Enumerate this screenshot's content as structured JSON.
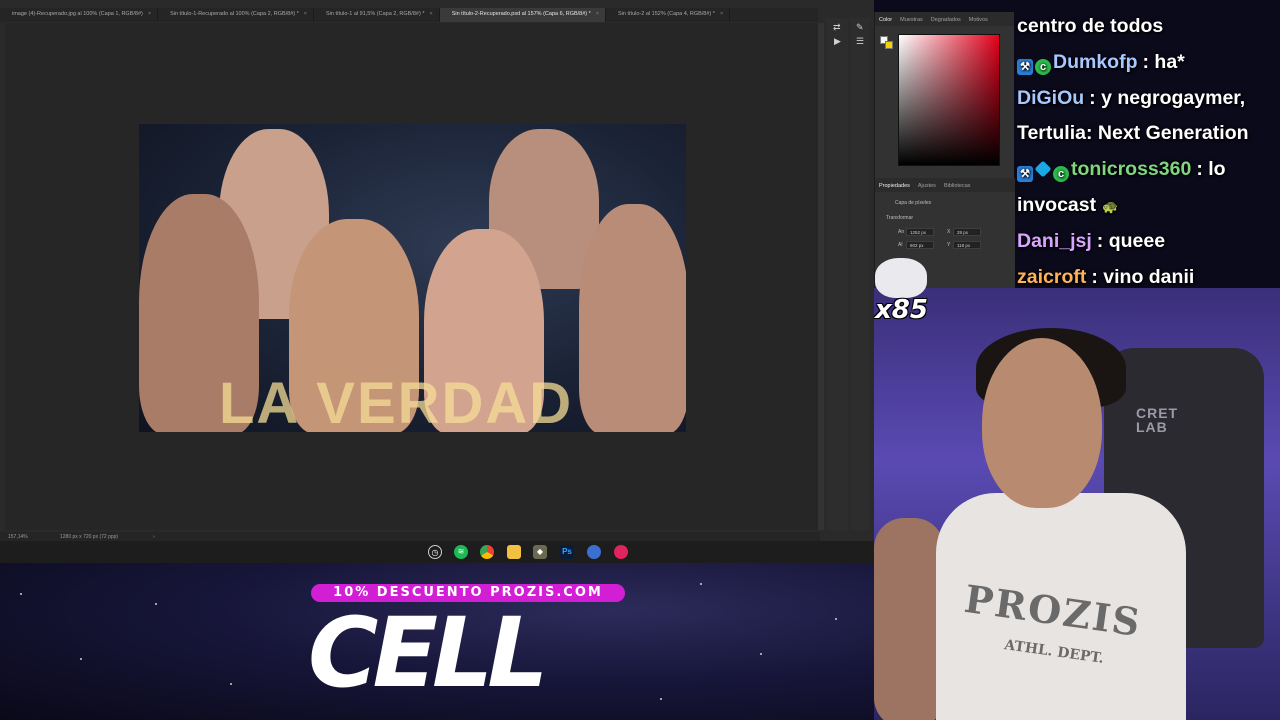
{
  "photoshop": {
    "tabs": [
      {
        "label": "image (4)-Recuperado.jpg al 100% (Capa 1, RGB/8#)",
        "close": "×",
        "active": false
      },
      {
        "label": "Sin título-1-Recuperado al 100% (Capa 2, RGB/8#) *",
        "close": "×",
        "active": false
      },
      {
        "label": "Sin título-1 al 91,5% (Capa 2, RGB/8#) *",
        "close": "×",
        "active": false
      },
      {
        "label": "Sin título-2-Recuperado.psd al 157% (Capa 6, RGB/8#) *",
        "close": "×",
        "active": true
      },
      {
        "label": "Sin título-2 al 152% (Capa 4, RGB/8#) *",
        "close": "×",
        "active": false
      }
    ],
    "canvas_title": "LA VERDAD",
    "status": {
      "zoom": "157,14%",
      "doc_size": "1280 px x 720 px (72 ppp)",
      "arrow": "›"
    }
  },
  "panels": {
    "top_tabs": [
      "Color",
      "Muestras",
      "Degradados",
      "Motivos"
    ],
    "bottom_tabs": [
      "Propiedades",
      "Ajustes",
      "Bibliotecas"
    ],
    "layer_type": "Capa de píxeles",
    "section": "Transformar",
    "fields": {
      "w_label": "An",
      "w": "1252 px",
      "x_label": "X",
      "x": "28 px",
      "h_label": "Al",
      "h": "602 px",
      "y_label": "Y",
      "y": "118 px"
    },
    "colors": {
      "foreground": "#f7f7f7",
      "background": "#f3d200"
    }
  },
  "chat": {
    "lines": [
      {
        "user": "",
        "text": "centro de todos",
        "color": "#ffffff"
      },
      {
        "user": "Dumkofp",
        "text": ": ha*",
        "color": "#a6c8ff",
        "badges": [
          "blue",
          "green"
        ]
      },
      {
        "user": "DiGiOu",
        "text": ": y negrogaymer,",
        "color": "#a6c8ff",
        "badges": []
      },
      {
        "user": "",
        "text": "Tertulia: Next Generation",
        "color": "#ffffff"
      },
      {
        "user": "tonicross360",
        "text": ": lo",
        "color": "#7fd67f",
        "badges": [
          "blue",
          "cube",
          "green"
        ]
      },
      {
        "user": "",
        "text": "invocast",
        "color": "#ffffff",
        "emoji": "🐢"
      },
      {
        "user": "Dani_jsj",
        "text": ": queee",
        "color": "#d9a6ff",
        "badges": []
      },
      {
        "user": "zaicroft",
        "text": ": vino danii",
        "color": "#ffb257",
        "badges": []
      }
    ]
  },
  "taskbar": {
    "icons": [
      "timer-icon",
      "spotify-icon",
      "chrome-icon",
      "folder-icon",
      "app-icon",
      "photoshop-icon",
      "browser-icon",
      "tiktok-icon"
    ],
    "ps_label": "Ps"
  },
  "promo": {
    "banner": "10% DESCUENTO PROZIS.COM",
    "brand": "CELL"
  },
  "webcam": {
    "chair_logo": "CRET\nLAB",
    "shirt_text": "PROZIS",
    "shirt_sub": "ATHL. DEPT."
  },
  "emote": {
    "count": "x85"
  }
}
